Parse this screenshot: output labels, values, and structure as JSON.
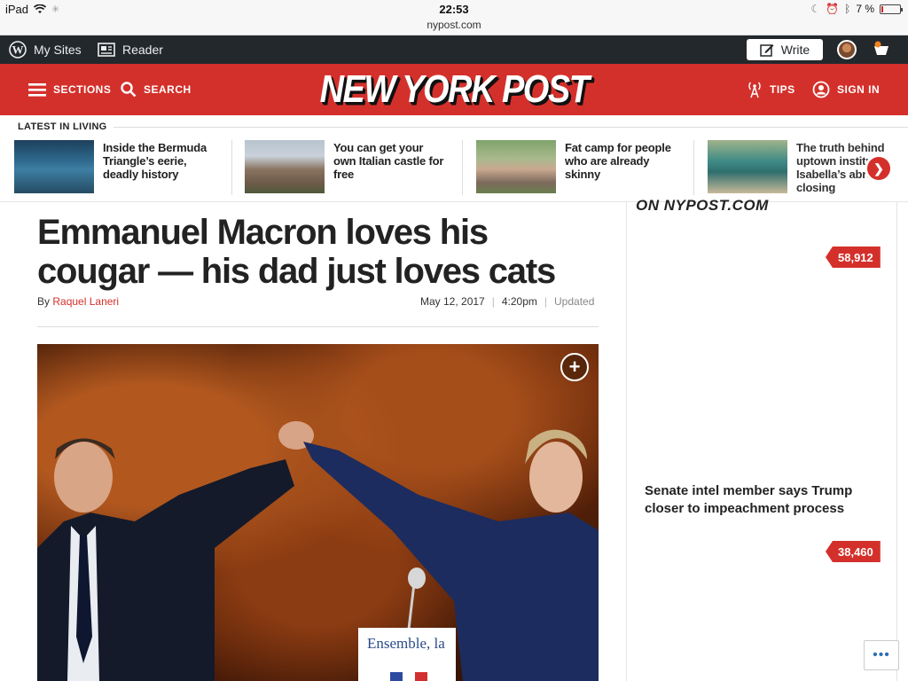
{
  "status_bar": {
    "device": "iPad",
    "time": "22:53",
    "url": "nypost.com",
    "battery": "7 %"
  },
  "wp_bar": {
    "my_sites": "My Sites",
    "reader": "Reader",
    "write": "Write"
  },
  "header": {
    "sections": "SECTIONS",
    "search": "SEARCH",
    "logo": "NEW YORK POST",
    "tips": "TIPS",
    "sign_in": "SIGN IN"
  },
  "latest": {
    "label": "LATEST IN LIVING",
    "items": [
      {
        "title": "Inside the Bermuda Triangle’s eerie, deadly history"
      },
      {
        "title": "You can get your own Italian castle for free"
      },
      {
        "title": "Fat camp for people who are already skinny"
      },
      {
        "title": "The truth behind uptown institu Isabella’s abru closing"
      }
    ]
  },
  "article": {
    "headline": "Emmanuel Macron loves his cougar — his dad just loves cats",
    "by": "By",
    "author": "Raquel Laneri",
    "date": "May 12, 2017",
    "time": "4:20pm",
    "updated": "Updated",
    "photo_sign": "Ensemble, la"
  },
  "sidebar": {
    "heading": "ON NYPOST.COM",
    "count1": "58,912",
    "story": "Senate intel member says Trump closer to impeachment process",
    "count2": "38,460"
  },
  "colors": {
    "brand_red": "#d4302b",
    "wp_bar": "#23282d"
  }
}
